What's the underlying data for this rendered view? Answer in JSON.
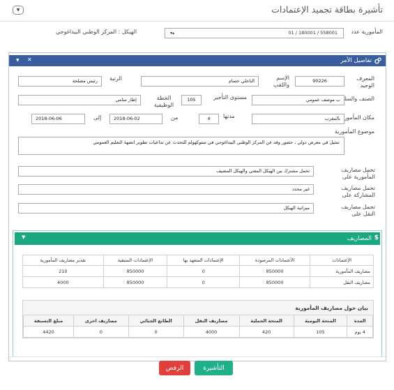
{
  "page": {
    "title": "تأشيرة بطاقة تجميد الإعتمادات",
    "collapse_icon": "chevron-down-icon"
  },
  "header_form": {
    "mission_no_label": "المأمورية عدد",
    "mission_no_value": "558001 / 180001 / 01",
    "structure_label": "الهيكل : المركز الوطني البيداغوجي"
  },
  "panel": {
    "title": "تفاصيل الأمر",
    "icon": "cogs-icon",
    "header_colors": {
      "bg": "#3a5da0"
    }
  },
  "form": {
    "id_label": "المعرف الوحيد",
    "id_value": "90226",
    "name_label": "الإسم واللقب",
    "name_value": "الناجلي  حسام",
    "rank_label": "الرتبة",
    "rank_value": "رئيس مصلحة",
    "class_label": "الصنف والسلك",
    "class_value": "ب  موصف عمومي",
    "level_label": "مستوى التأجير",
    "level_value": "105",
    "plan_label": "الخطة الوظيفية",
    "plan_value": "إطار سامي",
    "place_label": "مكان المأمورية",
    "place_value": "بالمغرب",
    "duration_label": "مدتها",
    "duration_value": "4",
    "from_label": "من",
    "from_value": "2018-06-02",
    "to_label": "إلى",
    "to_value": "2018-06-06",
    "subject_label": "موضوع المأمورية",
    "subject_value": "تمثيل في معرض دولي ، حضور وفد عن المركز الوطني البيداغوجي في ستوكهولم للتحدث عن تداعيات تطوير انصهة التعليم العمومي",
    "mission_cost_label": "تحمل مصاريف المأمورية على",
    "mission_cost_value": "تحمل مشترك بين الهيكل المعني والهيكل المضيف",
    "participation_cost_label": "تحمل مصاريف المشاركة على",
    "participation_cost_value": "غير محدد",
    "transport_cost_label": "تحمل مصاريف النقل على",
    "transport_cost_value": "ميزانية الهيكل"
  },
  "expenses": {
    "title": "المصاريف",
    "icon": "dollar-icon",
    "header_color": "#1aa881",
    "table1": {
      "headers": [
        "الإعتمادات",
        "الأعتمادات المرصودة",
        "الإعتمادات المتعهد بها",
        "الإعتمادات المتبقية",
        "تقدير مصاريف المأمورية"
      ],
      "rows": [
        [
          "مصاريف المأمورية",
          "850000",
          "0",
          "850000",
          "210"
        ],
        [
          "مصاريف النقل",
          "850000",
          "0",
          "850000",
          "4000"
        ]
      ]
    },
    "table2": {
      "caption": "بيان حول مصاريف المأمورية",
      "headers": [
        "المدة",
        "المنحة اليومية",
        "المنحة الجملية",
        "مصاريف النقل",
        "الطابع الجبائي",
        "مصاريف اخرى",
        "مبلغ التسبقة"
      ],
      "rows": [
        [
          "4 يوم",
          "105",
          "420",
          "4000",
          "0",
          "0",
          "4420"
        ]
      ]
    }
  },
  "actions": {
    "approve_label": "التأشيرة",
    "reject_label": "الرفض",
    "approve_color": "#1fb08a",
    "reject_color": "#e0403a"
  }
}
